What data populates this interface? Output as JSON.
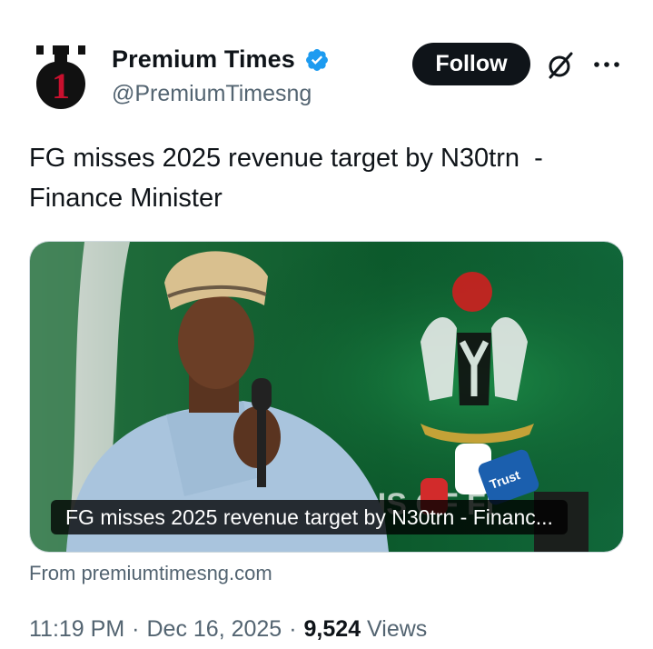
{
  "author": {
    "display_name": "Premium Times",
    "handle": "@PremiumTimesng",
    "logo_text": "1",
    "verified": true,
    "verified_color": "#1d9bf0",
    "logo_accent": "#c8102e"
  },
  "actions": {
    "follow_label": "Follow",
    "grok_icon": "grok-icon",
    "more_icon": "more-icon"
  },
  "tweet": {
    "text": "FG misses 2025 revenue target by N30trn  -\nFinance Minister"
  },
  "link_card": {
    "title": "FG misses 2025 revenue target by N30trn - Financ...",
    "source": "From premiumtimesng.com",
    "microphone_label": "Trust"
  },
  "meta": {
    "time": "11:19 PM",
    "separator": "·",
    "date": "Dec 16, 2025",
    "separator2": "·",
    "views_count": "9,524",
    "views_label": "Views"
  }
}
